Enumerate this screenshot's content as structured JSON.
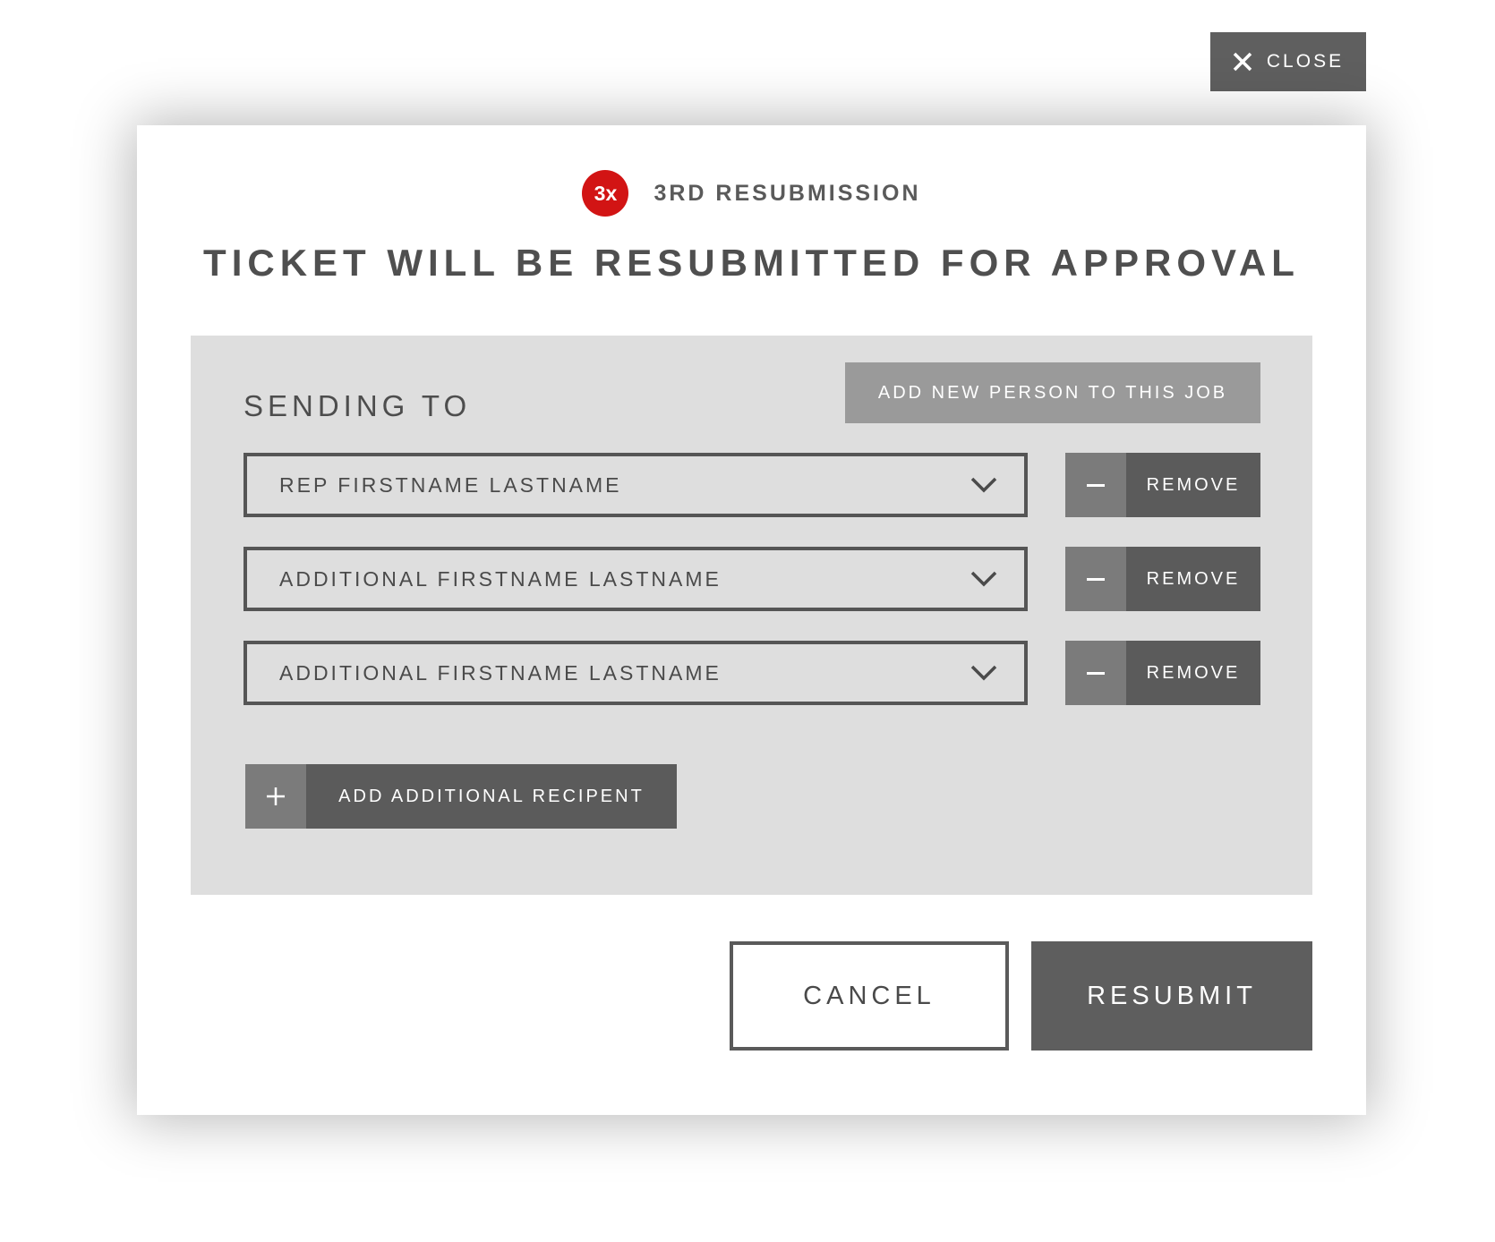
{
  "close_button": {
    "label": "CLOSE",
    "icon": "close-icon"
  },
  "header": {
    "badge": "3x",
    "badge_color": "#d21414",
    "resubmission_label": "3RD RESUBMISSION",
    "title": "TICKET WILL BE RESUBMITTED FOR APPROVAL"
  },
  "panel": {
    "heading": "SENDING TO",
    "add_person_label": "ADD NEW PERSON TO THIS JOB",
    "recipients": [
      {
        "value": "REP FIRSTNAME LASTNAME",
        "remove_label": "REMOVE"
      },
      {
        "value": "ADDITIONAL FIRSTNAME LASTNAME",
        "remove_label": "REMOVE"
      },
      {
        "value": "ADDITIONAL FIRSTNAME LASTNAME",
        "remove_label": "REMOVE"
      }
    ],
    "add_recipient_label": "ADD ADDITIONAL RECIPENT"
  },
  "footer": {
    "cancel_label": "CANCEL",
    "resubmit_label": "RESUBMIT"
  }
}
